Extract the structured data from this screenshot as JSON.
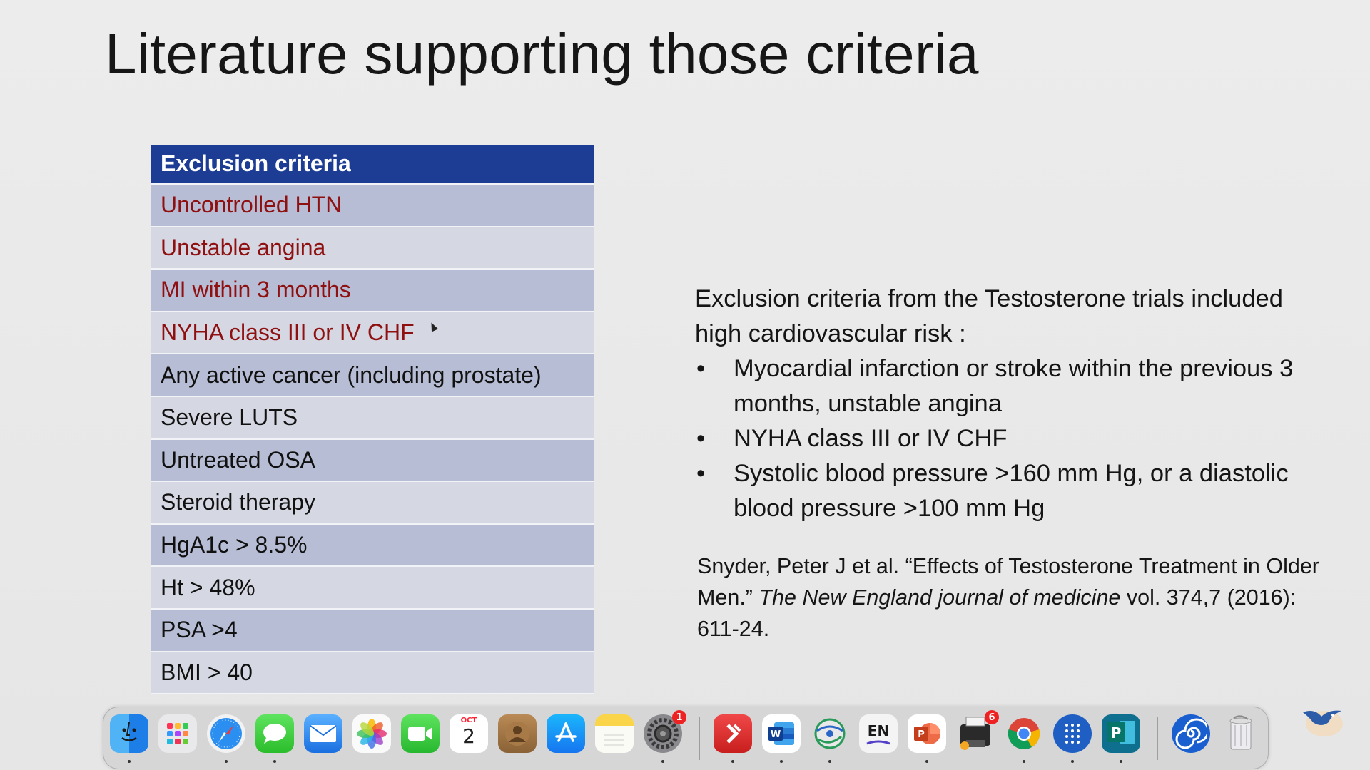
{
  "slide": {
    "title": "Literature supporting those criteria"
  },
  "table": {
    "header": "Exclusion criteria",
    "rows": [
      {
        "text": "Uncontrolled HTN",
        "color": "#8f1010"
      },
      {
        "text": "Unstable angina",
        "color": "#8f1010"
      },
      {
        "text": "MI within 3 months",
        "color": "#8f1010"
      },
      {
        "text": "NYHA class III or IV CHF",
        "color": "#8f1010"
      },
      {
        "text": "Any active cancer (including prostate)",
        "color": "#111111"
      },
      {
        "text": "Severe LUTS",
        "color": "#111111"
      },
      {
        "text": "Untreated OSA",
        "color": "#111111"
      },
      {
        "text": "Steroid therapy",
        "color": "#111111"
      },
      {
        "text": "HgA1c > 8.5%",
        "color": "#111111"
      },
      {
        "text": "Ht > 48%",
        "color": "#111111"
      },
      {
        "text": "PSA >4",
        "color": "#111111"
      },
      {
        "text": "BMI > 40",
        "color": "#111111"
      }
    ],
    "header_color": "#1d3d95"
  },
  "summary": {
    "intro_line1": "Exclusion criteria from the Testosterone trials included",
    "intro_line2": "high cardiovascular risk :",
    "bullets": [
      "Myocardial infarction or stroke within the previous 3 months, unstable angina",
      "NYHA class III or IV CHF",
      "Systolic blood pressure >160 mm Hg, or a diastolic blood pressure >100 mm Hg"
    ]
  },
  "citation": {
    "authors_title": "Snyder, Peter J et al. “Effects of Testosterone Treatment in Older Men.”",
    "journal": "The New England journal of medicine",
    "details": "vol. 374,7 (2016): 611-24."
  },
  "dock": {
    "calendar_month": "OCT",
    "calendar_day": "2",
    "settings_badge": "1",
    "app_badge": "6",
    "keyboard_label": "EN",
    "icons": [
      "finder-icon",
      "launchpad-icon",
      "safari-icon",
      "messages-icon",
      "mail-icon",
      "photos-icon",
      "facetime-icon",
      "calendar-icon",
      "contacts-icon",
      "app-store-icon",
      "notes-icon",
      "system-settings-icon",
      "remote-desktop-icon",
      "word-icon",
      "network-icon",
      "input-source-icon",
      "powerpoint-icon",
      "printer-icon",
      "chrome-icon",
      "dots-app-icon",
      "publisher-icon",
      "spiral-app-icon",
      "trash-icon"
    ]
  }
}
